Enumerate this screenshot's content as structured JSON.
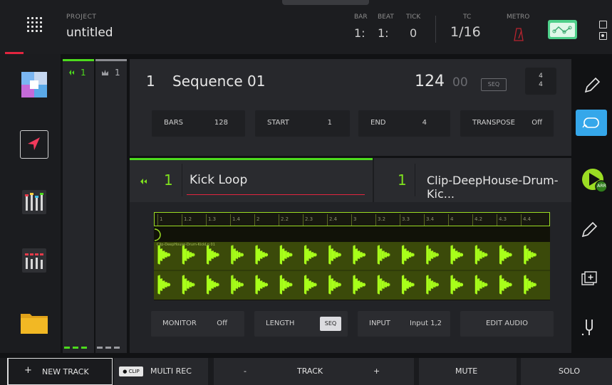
{
  "header": {
    "project_label": "PROJECT",
    "project_name": "untitled",
    "bar_label": "BAR",
    "bar_value": "1:",
    "beat_label": "BEAT",
    "beat_value": "1:",
    "tick_label": "TICK",
    "tick_value": "0",
    "tc_label": "TC",
    "tc_value": "1/16",
    "metro_label": "METRO",
    "icons": [
      "grid-menu-icon",
      "metronome-icon",
      "automation-icon",
      "window-icon",
      "record-icon"
    ]
  },
  "sidebar": {
    "items": [
      {
        "name": "pads",
        "icon": "pads-icon"
      },
      {
        "name": "arranger",
        "icon": "arrow-icon"
      },
      {
        "name": "mixer",
        "icon": "mixer-icon"
      },
      {
        "name": "channel-mixer",
        "icon": "channel-mixer-icon"
      },
      {
        "name": "browser",
        "icon": "folder-icon"
      }
    ]
  },
  "tracks": [
    {
      "label": "1",
      "icon": "audio-track-icon",
      "color": "#4ddb1d"
    },
    {
      "label": "1",
      "icon": "crown-icon",
      "color": "#9a9ba0"
    }
  ],
  "sequence": {
    "number": "1",
    "name": "Sequence 01",
    "bpm": "124",
    "bpm_fraction": "00",
    "mode_badge": "SEQ",
    "time_sig_top": "4",
    "time_sig_bottom": "4",
    "params": [
      {
        "key": "BARS",
        "value": "128"
      },
      {
        "key": "START",
        "value": "1"
      },
      {
        "key": "END",
        "value": "4"
      },
      {
        "key": "TRANSPOSE",
        "value": "Off"
      }
    ]
  },
  "clip": {
    "track_number": "1",
    "track_name": "Kick Loop",
    "clip_number": "1",
    "clip_name": "Clip-DeepHouse-Drum-Kic...",
    "waveform_label": "Clip-DeepHouse-Drum-KickLp 01",
    "play_badge": "ARR",
    "ruler_labels": [
      "1",
      "1.2",
      "1.3",
      "1.4",
      "2",
      "2.2",
      "2.3",
      "2.4",
      "3",
      "3.2",
      "3.3",
      "3.4",
      "4",
      "4.2",
      "4.3",
      "4.4"
    ],
    "controls": {
      "monitor_label": "MONITOR",
      "monitor_value": "Off",
      "length_label": "LENGTH",
      "length_chip": "SEQ",
      "input_label": "INPUT",
      "input_value": "Input 1,2",
      "edit_audio_label": "EDIT AUDIO"
    }
  },
  "right_tools": [
    "pencil-icon",
    "loop-icon",
    "pencil-icon",
    "add-layer-icon",
    "tuning-fork-icon"
  ],
  "bottom_bar": {
    "new_track": "NEW TRACK",
    "new_track_plus": "+",
    "clip_chip": "● CLIP",
    "multi_rec": "MULTI REC",
    "minus": "-",
    "track": "TRACK",
    "plus": "+",
    "mute": "MUTE",
    "solo": "SOLO"
  },
  "colors": {
    "accent_green": "#4ddb1d",
    "clip_green": "#7fe21e",
    "accent_red": "#e2253f",
    "loop_blue": "#35a7ea",
    "auto_green": "#4ed08a"
  }
}
